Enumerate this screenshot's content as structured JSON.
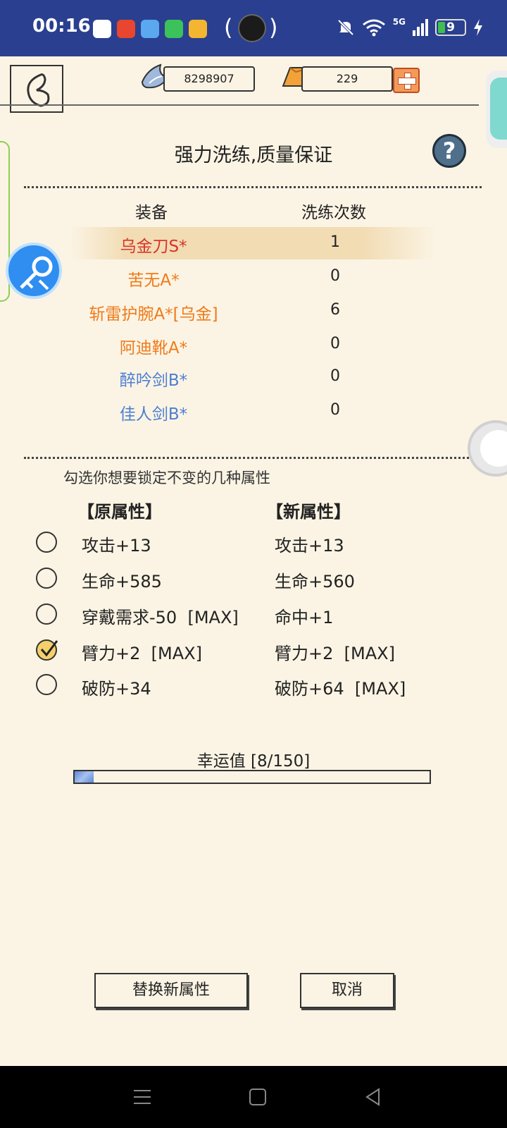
{
  "status_bar": {
    "time": "00:16",
    "battery": "9",
    "network": "5G"
  },
  "currency": {
    "silver": "8298907",
    "gold": "229"
  },
  "panel": {
    "title": "强力洗练,质量保证",
    "help_symbol": "?",
    "col_equipment": "装备",
    "col_count": "洗练次数"
  },
  "equipment": [
    {
      "name": "乌金刀S*",
      "count": "1",
      "color": "#d9342b",
      "selected": true
    },
    {
      "name": "苦无A*",
      "count": "0",
      "color": "#ef7a1a"
    },
    {
      "name": "斩雷护腕A*[乌金]",
      "count": "6",
      "color": "#ef7a1a"
    },
    {
      "name": "阿迪靴A*",
      "count": "0",
      "color": "#ef7a1a"
    },
    {
      "name": "醉吟剑B*",
      "count": "0",
      "color": "#4c7ed3"
    },
    {
      "name": "佳人剑B*",
      "count": "0",
      "color": "#4c7ed3"
    }
  ],
  "lock": {
    "hint": "勾选你想要锁定不变的几种属性",
    "old_header": "【原属性】",
    "new_header": "【新属性】",
    "rows": [
      {
        "old": "攻击+13",
        "new": "攻击+13",
        "checked": false
      },
      {
        "old": "生命+585",
        "new": "生命+560",
        "checked": false
      },
      {
        "old": "穿戴需求-50  [MAX]",
        "new": "命中+1",
        "checked": false
      },
      {
        "old": "臂力+2  [MAX]",
        "new": "臂力+2  [MAX]",
        "checked": true
      },
      {
        "old": "破防+34",
        "new": "破防+64  [MAX]",
        "checked": false
      }
    ]
  },
  "luck": {
    "label": "幸运值 [8/150]",
    "value": 8,
    "max": 150
  },
  "buttons": {
    "replace": "替换新属性",
    "cancel": "取消"
  },
  "colors": {
    "status_bar": "#2a3f8f",
    "background": "#fbf4e4",
    "rank_s": "#d9342b",
    "rank_a": "#ef7a1a",
    "rank_b": "#4c7ed3"
  }
}
